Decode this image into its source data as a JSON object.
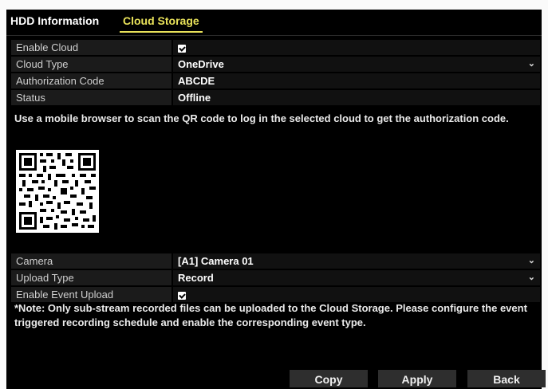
{
  "tabs": [
    {
      "label": "HDD Information"
    },
    {
      "label": "Cloud Storage"
    }
  ],
  "fields": {
    "enable_cloud": {
      "label": "Enable Cloud",
      "checked": true
    },
    "cloud_type": {
      "label": "Cloud Type",
      "value": "OneDrive"
    },
    "authorization_code": {
      "label": "Authorization Code",
      "value": "ABCDE"
    },
    "status": {
      "label": "Status",
      "value": "Offline"
    },
    "camera": {
      "label": "Camera",
      "value": "[A1] Camera 01"
    },
    "upload_type": {
      "label": "Upload Type",
      "value": "Record"
    },
    "enable_event_upload": {
      "label": "Enable Event Upload",
      "checked": true
    }
  },
  "qr_instruction": "Use a mobile browser to scan the QR code to log in the selected cloud to get the authorization code.",
  "note": "*Note: Only sub-stream recorded files can be uploaded to the Cloud Storage. Please configure the event triggered recording schedule and enable the corresponding event type.",
  "buttons": {
    "copy": "Copy",
    "apply": "Apply",
    "back": "Back"
  },
  "icons": {
    "dropdown": "chevron-down-icon",
    "checkbox": "checkbox-checked-icon",
    "qr": "qr-code-icon"
  },
  "colors": {
    "active_tab": "#e9e25a",
    "background": "#000000"
  }
}
